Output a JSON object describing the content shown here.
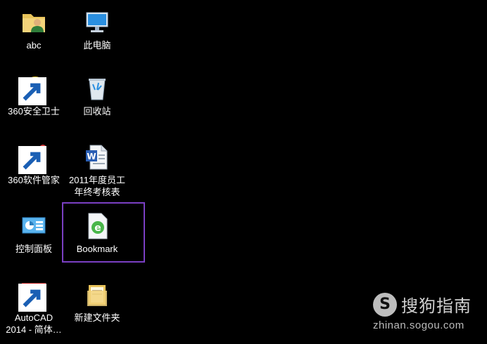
{
  "desktop": {
    "icons": [
      {
        "label": "abc"
      },
      {
        "label": "此电脑"
      },
      {
        "label": "360安全卫士"
      },
      {
        "label": "回收站"
      },
      {
        "label": "360软件管家"
      },
      {
        "label": "2011年度员工\n年终考核表"
      },
      {
        "label": "控制面板"
      },
      {
        "label": "Bookmark"
      },
      {
        "label": "AutoCAD\n2014 - 简体…"
      },
      {
        "label": "新建文件夹"
      }
    ],
    "selection_color": "#7a3fc3"
  },
  "watermark": {
    "logo_letter": "S",
    "name": "搜狗指南",
    "url": "zhinan.sogou.com"
  }
}
